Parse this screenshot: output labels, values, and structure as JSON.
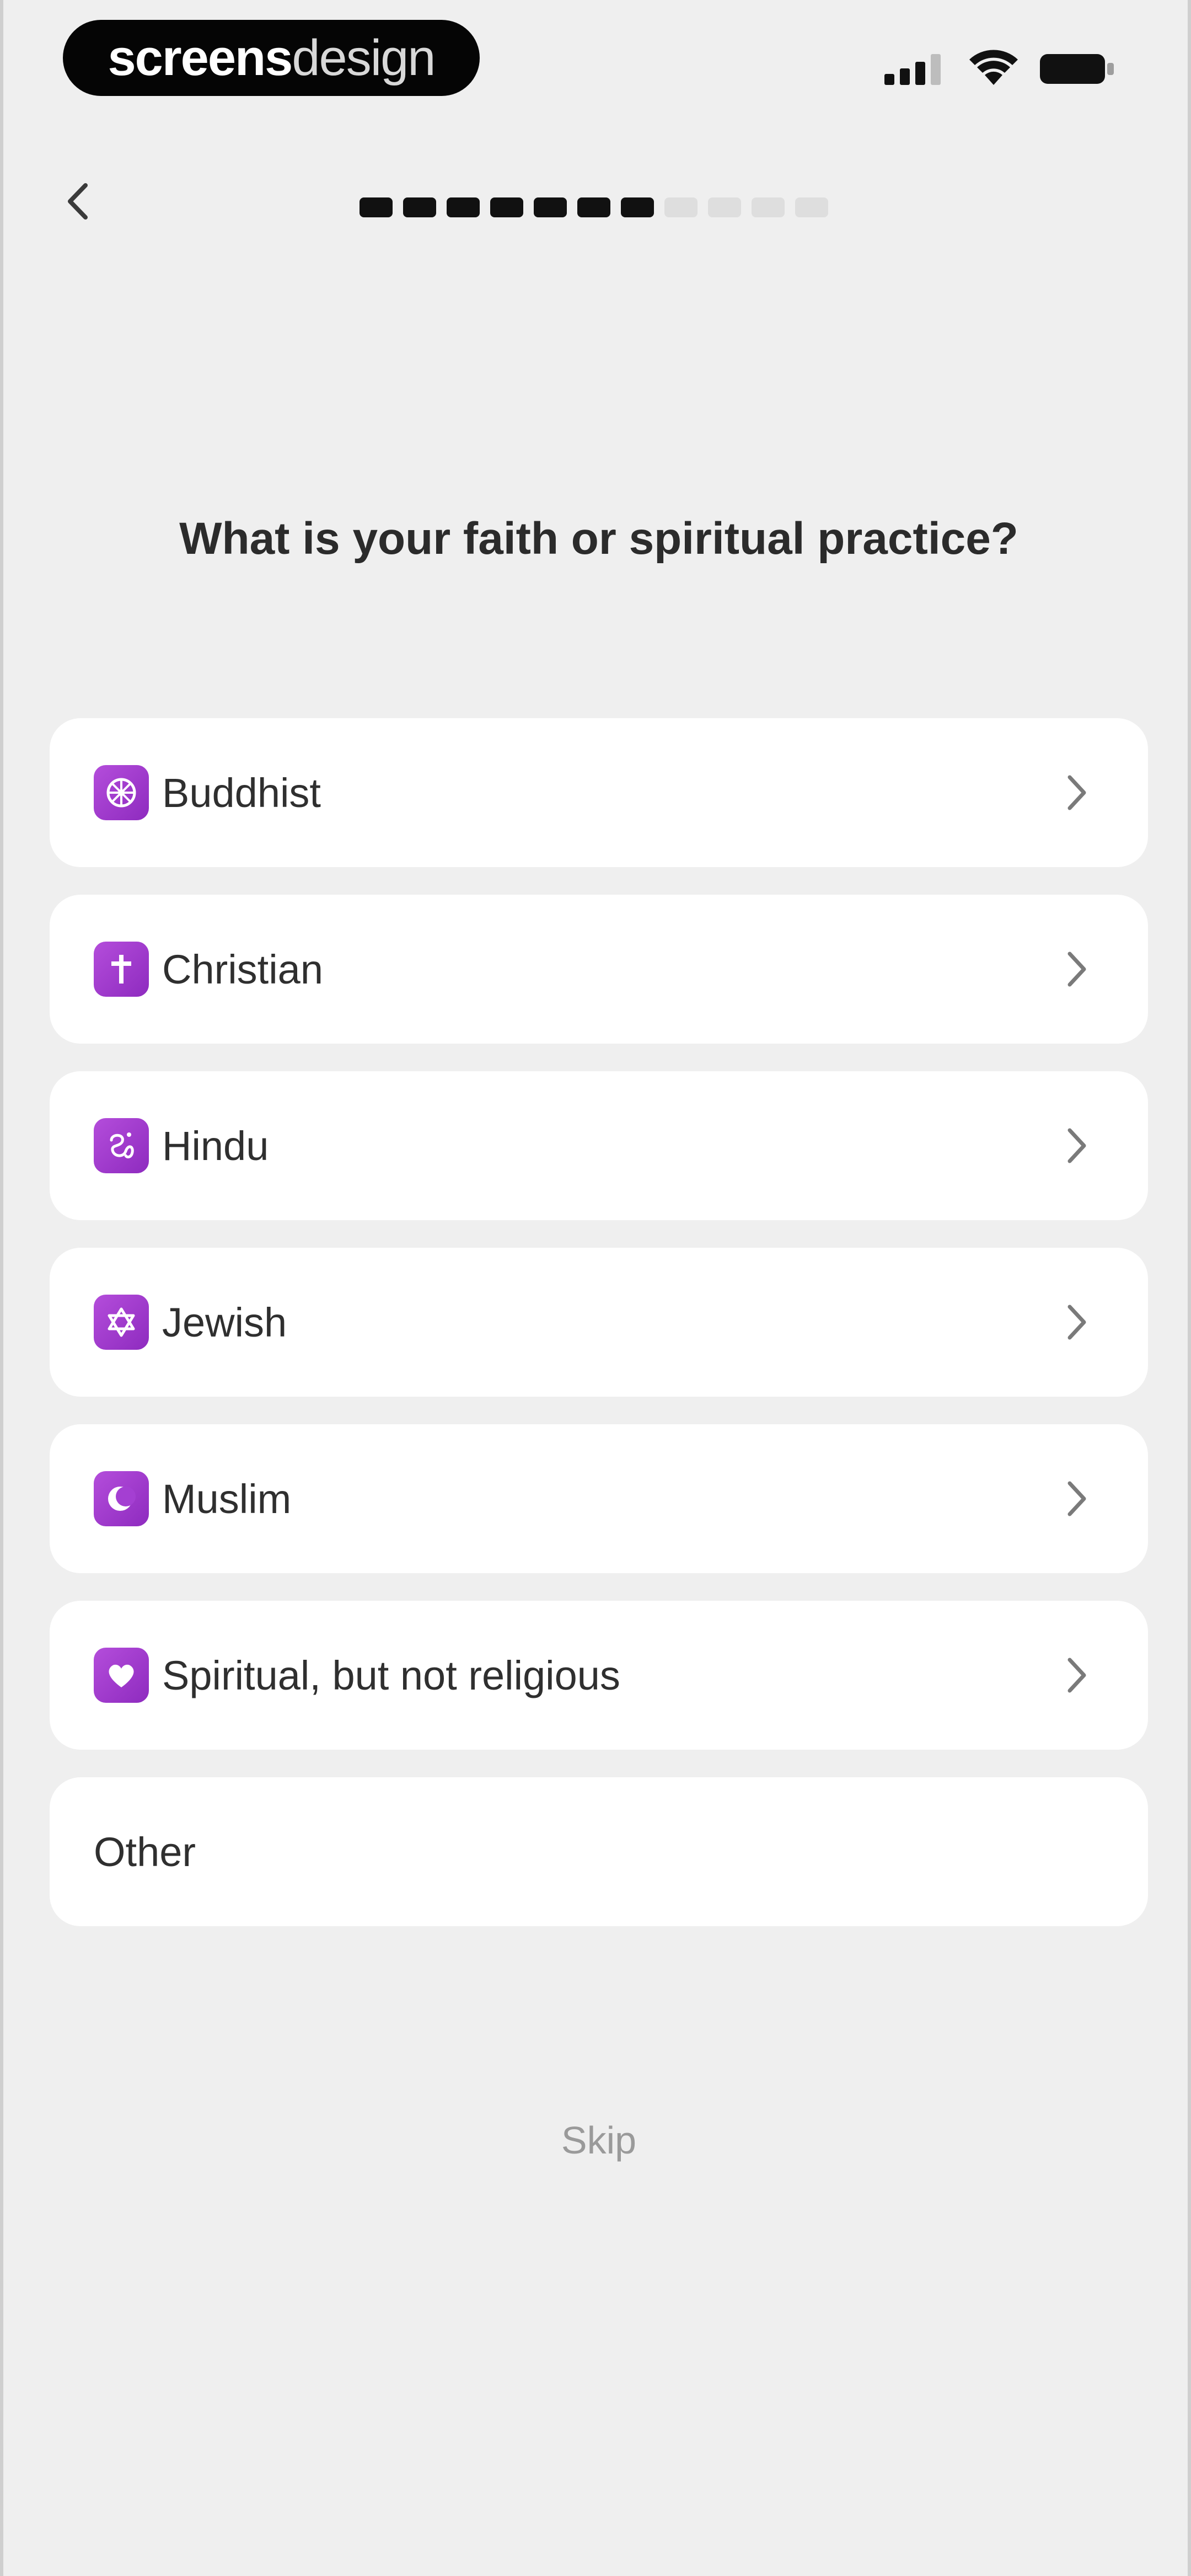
{
  "status_bar": {
    "brand_primary": "screens",
    "brand_secondary": "design",
    "icons": [
      "cellular-signal-icon",
      "wifi-icon",
      "battery-icon"
    ]
  },
  "nav": {
    "back_icon": "chevron-left-icon",
    "progress": {
      "total_steps": 11,
      "completed_steps": 7
    }
  },
  "question": "What is your faith or spiritual practice?",
  "options": [
    {
      "label": "Buddhist",
      "icon": "dharma-wheel-icon"
    },
    {
      "label": "Christian",
      "icon": "cross-icon"
    },
    {
      "label": "Hindu",
      "icon": "om-icon"
    },
    {
      "label": "Jewish",
      "icon": "star-of-david-icon"
    },
    {
      "label": "Muslim",
      "icon": "crescent-icon"
    },
    {
      "label": "Spiritual, but not religious",
      "icon": "heart-icon"
    }
  ],
  "other_label": "Other",
  "skip_label": "Skip",
  "colors": {
    "background": "#efefef",
    "card": "#ffffff",
    "accent": "#9b36c9",
    "progress_done": "#111111",
    "progress_todo": "#dedede",
    "muted": "#9a9a9a"
  }
}
